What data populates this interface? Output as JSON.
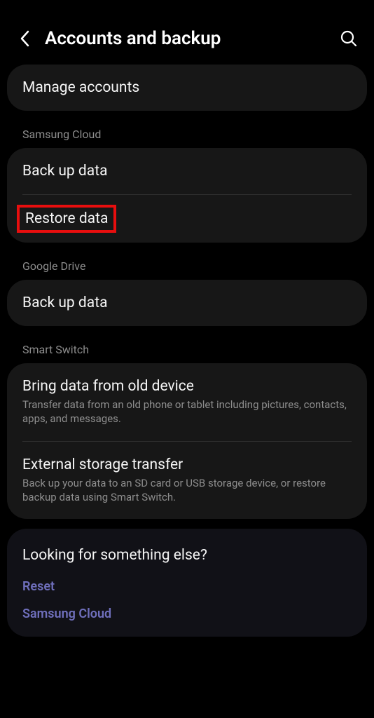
{
  "header": {
    "title": "Accounts and backup"
  },
  "sections": {
    "manage": {
      "label": "Manage accounts"
    },
    "samsungCloud": {
      "header": "Samsung Cloud",
      "backup": "Back up data",
      "restore": "Restore data"
    },
    "googleDrive": {
      "header": "Google Drive",
      "backup": "Back up data"
    },
    "smartSwitch": {
      "header": "Smart Switch",
      "bring": {
        "title": "Bring data from old device",
        "desc": "Transfer data from an old phone or tablet including pictures, contacts, apps, and messages."
      },
      "external": {
        "title": "External storage transfer",
        "desc": "Back up your data to an SD card or USB storage device, or restore backup data using Smart Switch."
      }
    }
  },
  "footer": {
    "title": "Looking for something else?",
    "links": {
      "reset": "Reset",
      "samsungCloud": "Samsung Cloud"
    }
  }
}
